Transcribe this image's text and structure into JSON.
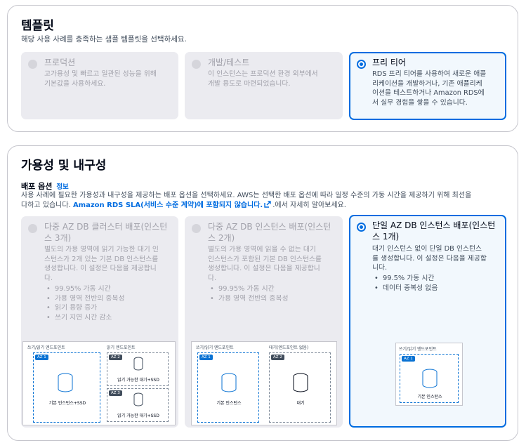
{
  "template": {
    "title": "템플릿",
    "desc": "해당 사용 사례를 충족하는 샘플 템플릿을 선택하세요.",
    "cards": [
      {
        "title": "프로덕션",
        "desc": [
          "고가용성 및 빠르고 일관된 성능을 위해",
          "기본값을 사용하세요."
        ],
        "selected": false
      },
      {
        "title": "개발/테스트",
        "desc": [
          "이 인스턴스는 프로덕션 환경 외부에서",
          "개발 용도로 마련되었습니다."
        ],
        "selected": false
      },
      {
        "title": "프리 티어",
        "desc": [
          "RDS 프리 티어를 사용하여 새로운 애플",
          "리케이션을 개발하거나, 기존 애플리케",
          "이션을 테스트하거나 Amazon RDS에",
          "서 실무 경험을 쌓을 수 있습니다."
        ],
        "selected": true
      }
    ]
  },
  "avail": {
    "title": "가용성 및 내구성",
    "sub_label": "배포 옵션",
    "info": "정보",
    "desc_line1": "사용 사례에 필요한 가용성과 내구성을 제공하는 배포 옵션을 선택하세요. AWS는 선택한 배포 옵션에 따라 일정 수준의 가동 시간을 제공하기 위해 최선을",
    "desc_line2_a": "다하고 있습니다. ",
    "desc_link": "Amazon RDS SLA(서비스 수준 계약)에 포함되지 않습니다.",
    "desc_line2_b": ".에서 자세히 알아보세요.",
    "cards": [
      {
        "title": [
          "다중 AZ DB 클러스터 배포(인스턴",
          "스 3개)"
        ],
        "desc": [
          "별도의 가용 영역에 읽기 가능한 대기 인",
          "스턴스가 2개 있는 기본 DB 인스턴스를",
          "생성합니다. 이 설정은 다음을 제공합니",
          "다."
        ],
        "bullets": [
          "99.95% 가동 시간",
          "가용 영역 전반의 중복성",
          "읽기 용량 증가",
          "쓰기 지연 시간 감소"
        ],
        "selected": false
      },
      {
        "title": [
          "다중 AZ DB 인스턴스 배포(인스턴",
          "스 2개)"
        ],
        "desc": [
          "별도의 가용 영역에 읽을 수 없는 대기",
          "인스턴스가 포함된 기본 DB 인스턴스를",
          "생성합니다. 이 설정은 다음을 제공합니",
          "다."
        ],
        "bullets": [
          "99.95% 가동 시간",
          "가용 영역 전반의 중복성"
        ],
        "selected": false
      },
      {
        "title": [
          "단일 AZ DB 인스턴스 배포(인스턴",
          "스 1개)"
        ],
        "desc": [
          "대기 인스턴스 없이 단일 DB 인스턴스",
          "를 생성합니다. 이 설정은 다음을 제공합",
          "니다."
        ],
        "bullets": [
          "99.5% 가동 시간",
          "데이터 중복성 없음"
        ],
        "selected": true
      }
    ],
    "diagram": {
      "rw_endpoint": "쓰기/읽기 엔드포인트",
      "read_endpoint": "읽기 엔드포인트",
      "standby_endpoint": "대기(엔드포인트 없음)",
      "az1": "AZ 1",
      "az2": "AZ 2",
      "az3": "AZ 3",
      "primary_ssd": "기본 인스턴스+SSD",
      "readable_standby_ssd": "읽기 가능한 대기+SSD",
      "primary": "기본 인스턴스",
      "standby": "대기"
    }
  }
}
